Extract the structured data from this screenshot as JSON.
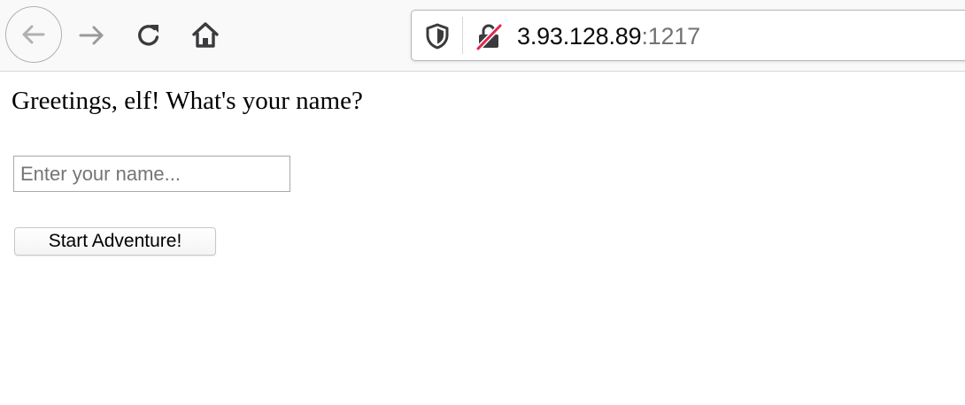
{
  "browser": {
    "url": {
      "host": "3.93.128.89",
      "port": ":1217"
    },
    "icons": {
      "back": "back-arrow-icon",
      "forward": "forward-arrow-icon",
      "reload": "reload-icon",
      "home": "home-icon",
      "tracking_protection": "shield-icon",
      "connection": "insecure-lock-icon"
    },
    "colors": {
      "toolbar_bg": "#f9f9fa",
      "insecure_strike": "#e22850",
      "icon": "#3b3b3d",
      "icon_disabled": "#9a9a9c"
    }
  },
  "page": {
    "greeting": "Greetings, elf! What's your name?",
    "name_input": {
      "value": "",
      "placeholder": "Enter your name..."
    },
    "start_button_label": "Start Adventure!"
  }
}
